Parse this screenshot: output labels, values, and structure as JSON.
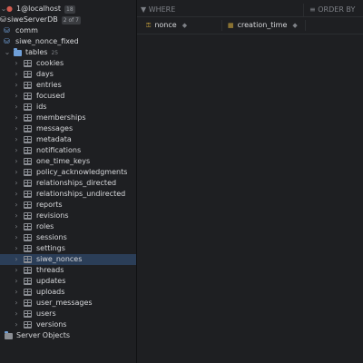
{
  "sidebar": {
    "connection": {
      "label": "1@localhost",
      "badge": "18"
    },
    "database": {
      "label": "siweServerDB",
      "badge": "2 of 7"
    },
    "schemas": [
      "comm",
      "siwe_nonce_fixed"
    ],
    "tables_folder": {
      "label": "tables",
      "count": "25"
    },
    "tables": [
      "cookies",
      "days",
      "entries",
      "focused",
      "ids",
      "memberships",
      "messages",
      "metadata",
      "notifications",
      "one_time_keys",
      "policy_acknowledgments",
      "relationships_directed",
      "relationships_undirected",
      "reports",
      "revisions",
      "roles",
      "sessions",
      "settings",
      "siwe_nonces",
      "threads",
      "updates",
      "uploads",
      "user_messages",
      "users",
      "versions"
    ],
    "selected_table": "siwe_nonces",
    "server_objects": "Server Objects"
  },
  "filter": {
    "where": "WHERE",
    "order_by": "ORDER BY"
  },
  "grid": {
    "columns": [
      {
        "name": "nonce",
        "sort": "◆"
      },
      {
        "name": "creation_time",
        "sort": "◆"
      }
    ]
  },
  "colors": {
    "selected_row": "#2b3e58",
    "folder": "#6f9fd8",
    "key": "#c9a33d"
  }
}
